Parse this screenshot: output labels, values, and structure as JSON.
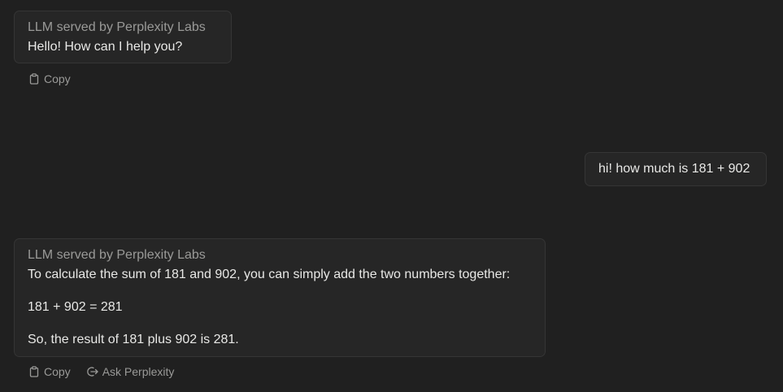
{
  "messages": {
    "bot_1": {
      "sender": "LLM served by Perplexity Labs",
      "text": "Hello! How can I help you?",
      "actions": {
        "copy_label": "Copy"
      }
    },
    "user_1": {
      "text": "hi! how much is 181 + 902"
    },
    "bot_2": {
      "sender": "LLM served by Perplexity Labs",
      "paragraphs": [
        "To calculate the sum of 181 and 902, you can simply add the two numbers together:",
        "181 + 902 = 281",
        "So, the result of 181 plus 902 is 281."
      ],
      "actions": {
        "copy_label": "Copy",
        "ask_label": "Ask Perplexity"
      }
    }
  },
  "icons": {
    "copy": "clipboard-icon",
    "ask": "arrow-out-icon"
  }
}
